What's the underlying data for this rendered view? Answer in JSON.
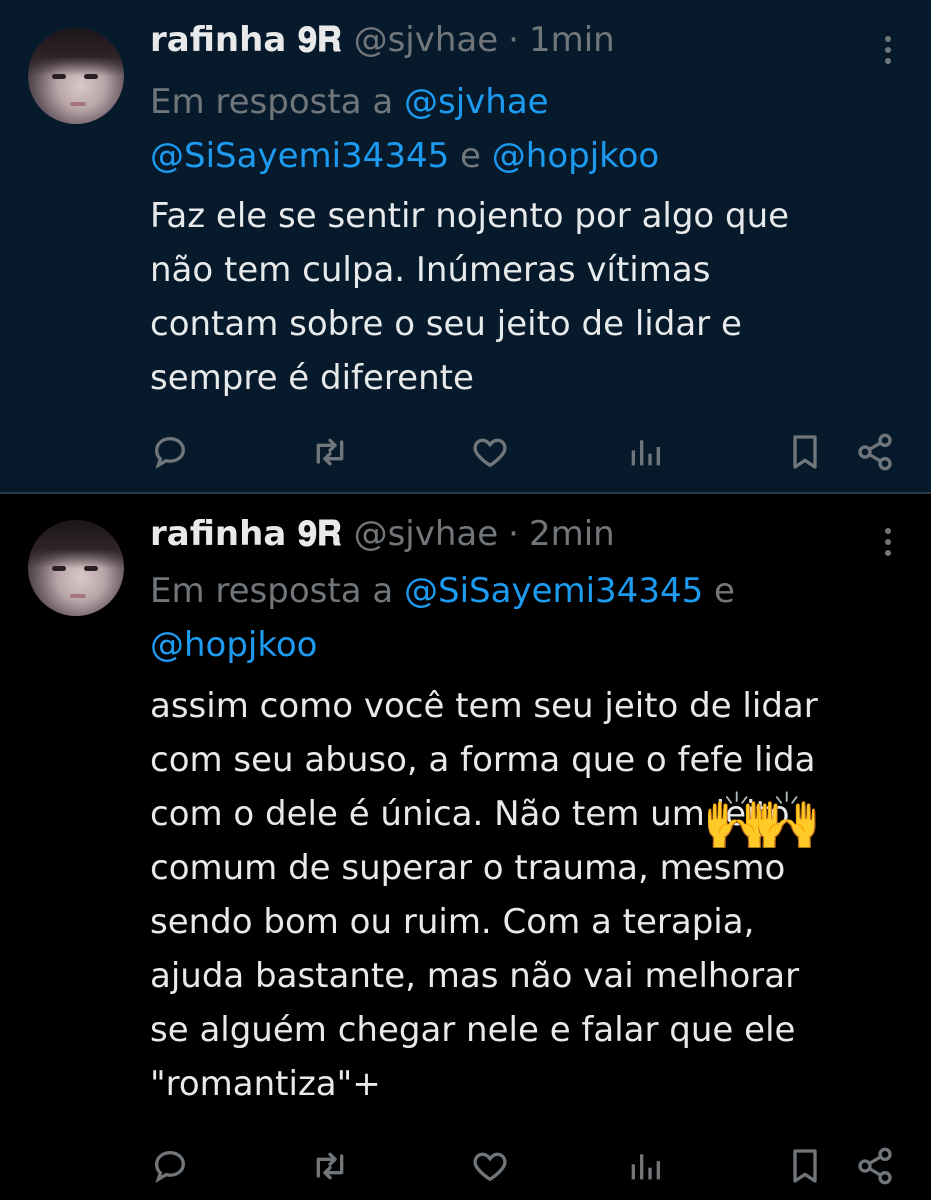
{
  "tweets": [
    {
      "author_name": "rafinha 𝟗𝐑",
      "handle": "@sjvhae",
      "separator": "·",
      "time": "1min",
      "reply_prefix": "Em resposta a",
      "reply_mentions": [
        "@sjvhae",
        "@SiSayemi34345"
      ],
      "reply_joiner": "e",
      "reply_last": "@hopjkoo",
      "text": "Faz ele se sentir nojento por algo que\nnão tem culpa. Inúmeras vítimas\ncontam sobre o seu jeito de lidar e\nsempre é diferente"
    },
    {
      "author_name": "rafinha 𝟗𝐑",
      "handle": "@sjvhae",
      "separator": "·",
      "time": "2min",
      "reply_prefix": "Em resposta a",
      "reply_mentions": [
        "@SiSayemi34345"
      ],
      "reply_joiner": "e",
      "reply_last": "@hopjkoo",
      "text": "assim como você tem seu jeito de lidar\ncom seu abuso, a forma que o fefe lida\ncom o dele é única. Não tem um jeito\ncomum de superar o trauma, mesmo\nsendo bom ou ruim. Com a terapia,\najuda bastante, mas não vai melhorar\nse alguém chegar nele e falar que ele\n\"romantiza\"+",
      "emoji": "🙌"
    }
  ],
  "icons": {
    "reply": "reply-icon",
    "retweet": "retweet-icon",
    "like": "like-icon",
    "views": "views-icon",
    "bookmark": "bookmark-icon",
    "share": "share-icon",
    "more": "more-icon"
  },
  "colors": {
    "background_highlight": "#061a2b",
    "background": "#000000",
    "text_primary": "#e7e9ea",
    "text_secondary": "#71767b",
    "accent": "#1d9bf0"
  }
}
